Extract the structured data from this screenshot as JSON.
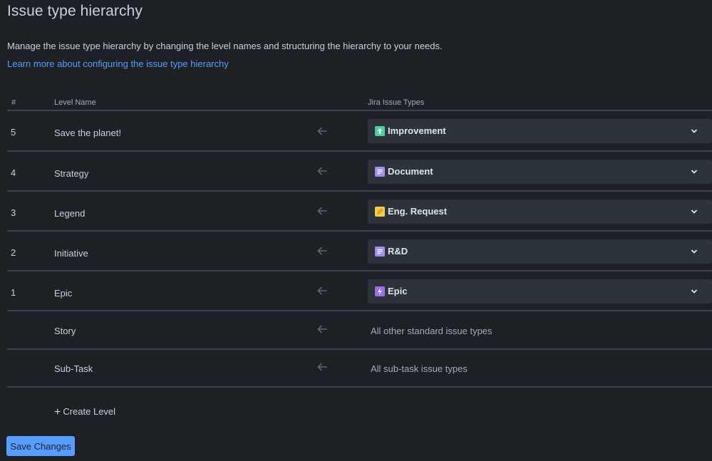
{
  "header": {
    "title": "Issue type hierarchy",
    "description": "Manage the issue type hierarchy by changing the level names and structuring the hierarchy to your needs.",
    "learn_more": "Learn more about configuring the issue type hierarchy"
  },
  "table": {
    "columns": {
      "num": "#",
      "name": "Level Name",
      "types": "Jira Issue Types"
    },
    "rows": [
      {
        "num": "5",
        "name": "Save the planet!",
        "type": "Improvement",
        "icon": "improvement-icon",
        "icon_color": "#4bce97"
      },
      {
        "num": "4",
        "name": "Strategy",
        "type": "Document",
        "icon": "document-icon",
        "icon_color": "#9f8fef"
      },
      {
        "num": "3",
        "name": "Legend",
        "type": "Eng. Request",
        "icon": "eng-request-icon",
        "icon_color": "#f5cd47"
      },
      {
        "num": "2",
        "name": "Initiative",
        "type": "R&D",
        "icon": "rnd-icon",
        "icon_color": "#9f8fef"
      },
      {
        "num": "1",
        "name": "Epic",
        "type": "Epic",
        "icon": "epic-icon",
        "icon_color": "#9f6cf0"
      }
    ],
    "fixed_rows": [
      {
        "name": "Story",
        "type": "All other standard issue types"
      },
      {
        "name": "Sub-Task",
        "type": "All sub-task issue types"
      }
    ]
  },
  "actions": {
    "create_level": "Create Level",
    "save": "Save Changes"
  },
  "colors": {
    "background": "#1d2125",
    "accent": "#579dff",
    "select_bg": "#2c333a",
    "divider": "#3a434c"
  }
}
